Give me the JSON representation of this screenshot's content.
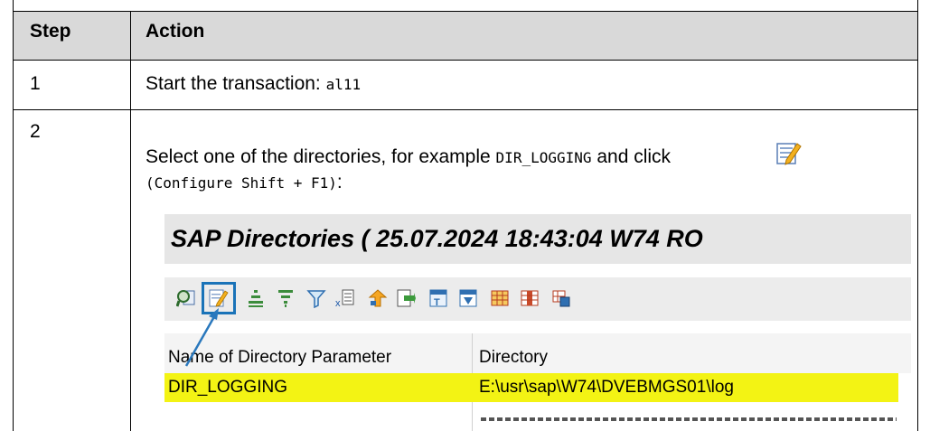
{
  "table": {
    "headers": [
      "Step",
      "Action"
    ],
    "rows": [
      {
        "step": "1",
        "text": "Start the transaction: ",
        "code": "al11"
      },
      {
        "step": "2",
        "text_before": "Select one of the directories, for example ",
        "code_example": "DIR_LOGGING",
        "text_after": " and click ",
        "code_hint": "(Configure Shift + F1)",
        "text_end": ":"
      }
    ]
  },
  "sap": {
    "title": "SAP Directories ( 25.07.2024 18:43:04 W74 RO",
    "toolbar_icons": [
      "find-icon",
      "configure-icon",
      "sort-ascending-icon",
      "sort-descending-icon",
      "filter-icon",
      "sum-icon",
      "export-icon",
      "spreadsheet-icon",
      "word-processing-icon",
      "layout-icon",
      "grid-icon",
      "grid-select-icon"
    ],
    "columns": [
      "Name of Directory Parameter",
      "Directory"
    ],
    "selected_row": {
      "name": "DIR_LOGGING",
      "path": "E:\\usr\\sap\\W74\\DVEBMGS01\\log"
    }
  },
  "colors": {
    "header_bg": "#d9d9d9",
    "highlight": "#f3f314",
    "selection_border": "#1a73b8"
  }
}
